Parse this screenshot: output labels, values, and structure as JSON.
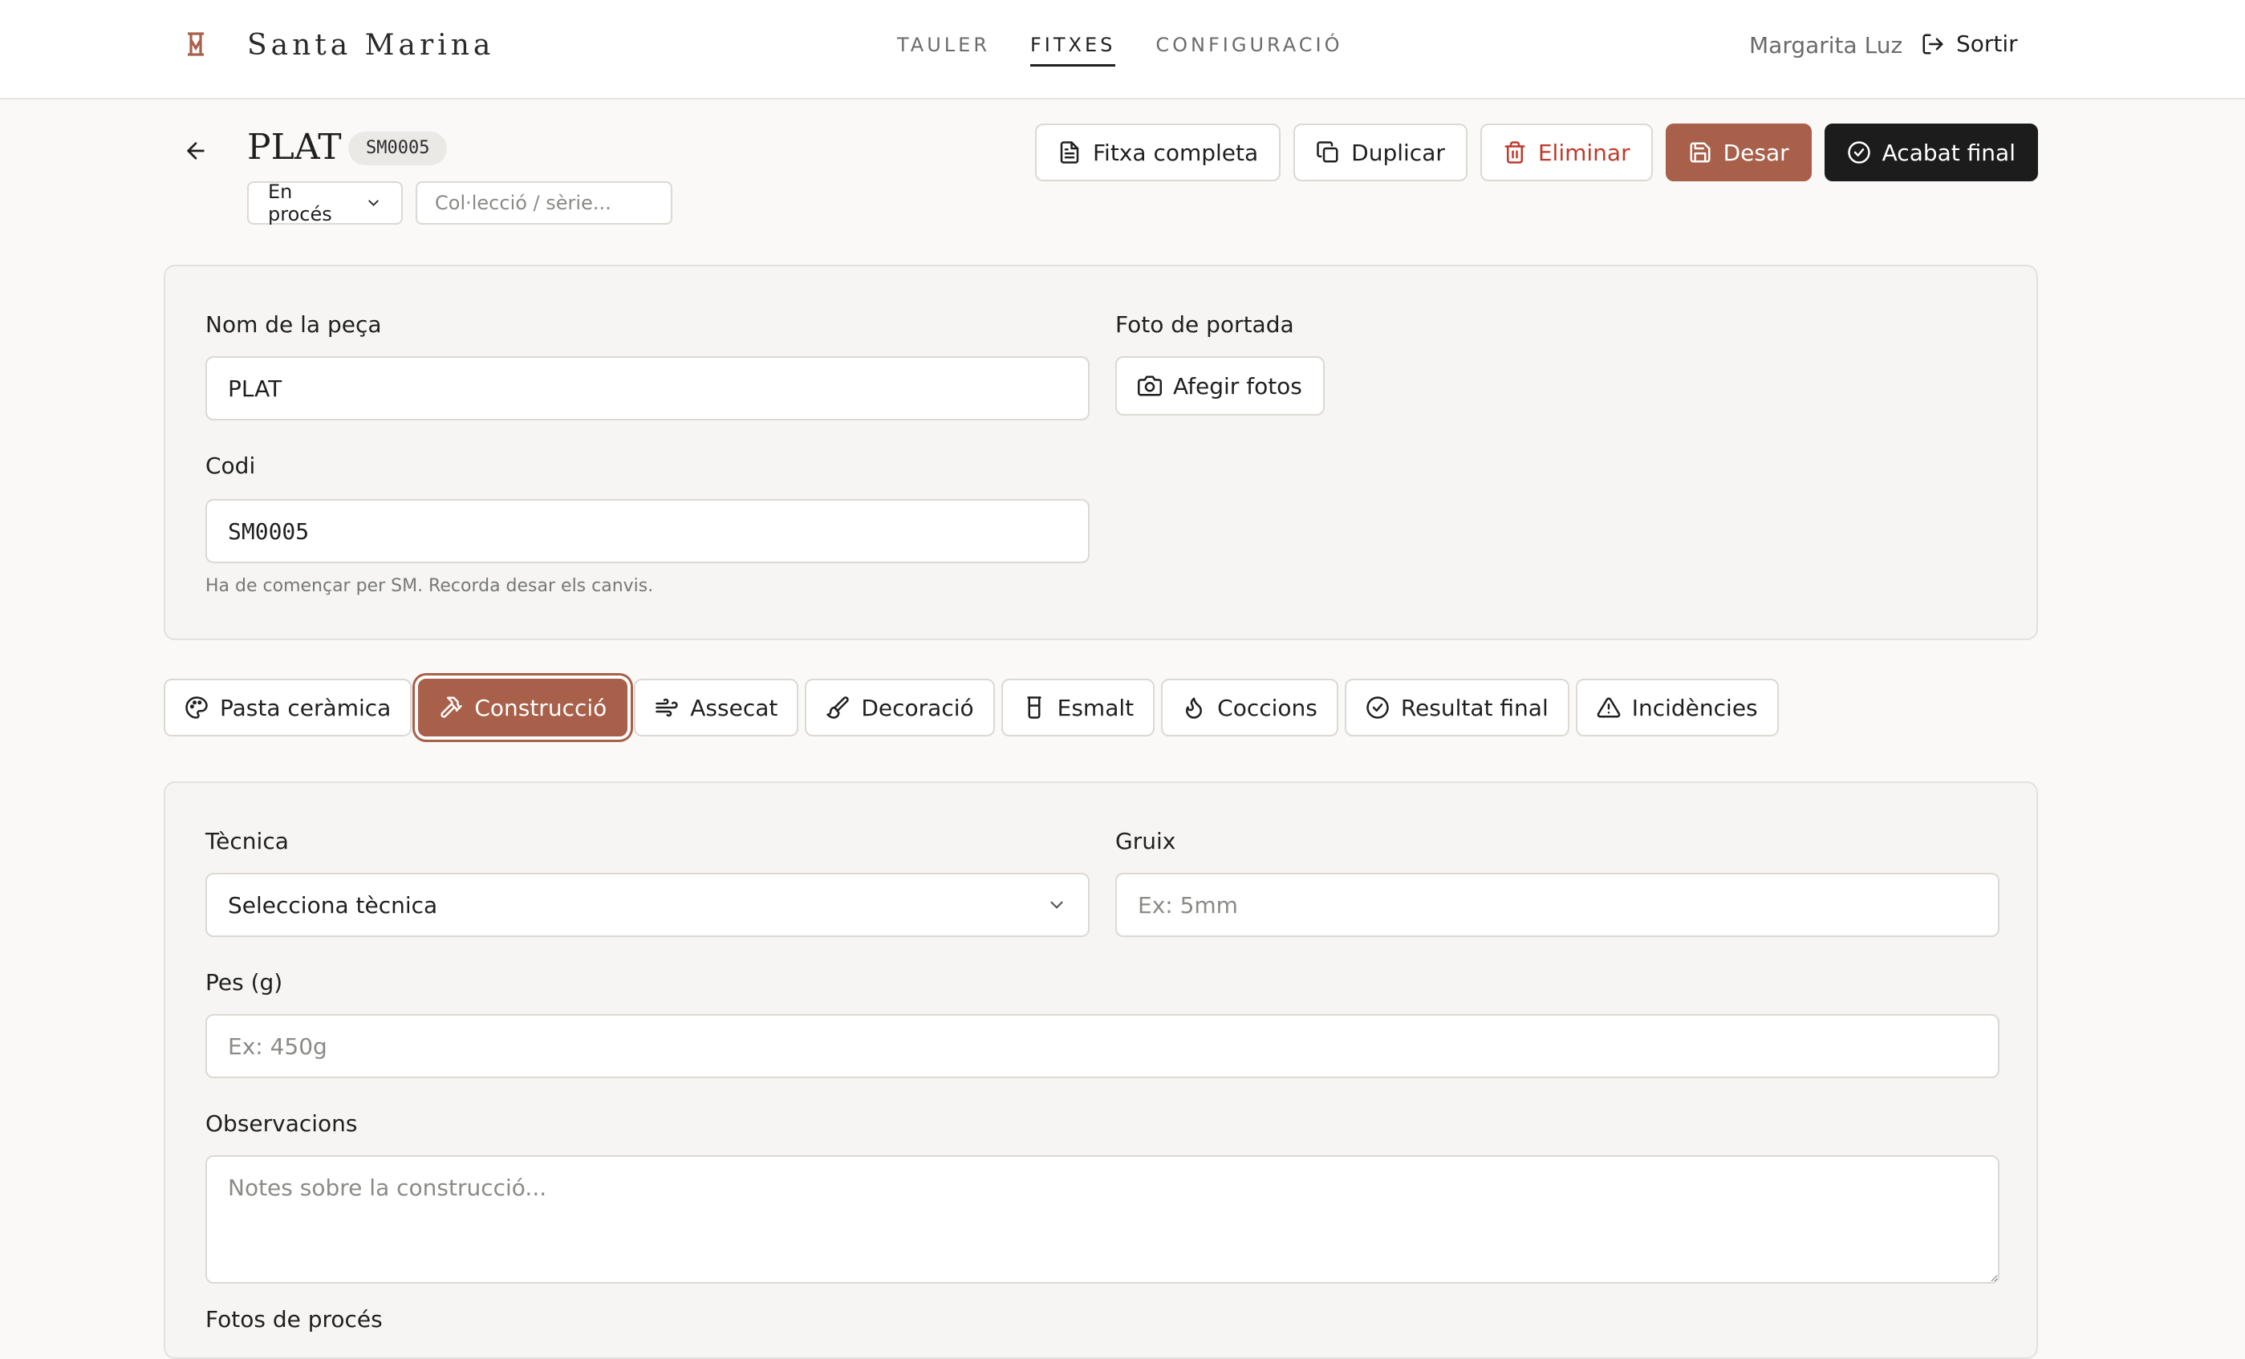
{
  "header": {
    "brand": "Santa Marina",
    "nav": [
      {
        "label": "TAULER",
        "active": false
      },
      {
        "label": "FITXES",
        "active": true
      },
      {
        "label": "CONFIGURACIÓ",
        "active": false
      }
    ],
    "user_name": "Margarita Luz",
    "logout_label": "Sortir",
    "brand_color": "#a8604a"
  },
  "piece": {
    "title": "PLAT",
    "code_badge": "SM0005",
    "status": "En procés",
    "collection_placeholder": "Col·lecció / sèrie..."
  },
  "actions": {
    "full_sheet": "Fitxa completa",
    "duplicate": "Duplicar",
    "delete": "Eliminar",
    "save": "Desar",
    "finish": "Acabat final"
  },
  "general": {
    "name_label": "Nom de la peça",
    "name_value": "PLAT",
    "cover_label": "Foto de portada",
    "add_photos": "Afegir fotos",
    "code_label": "Codi",
    "code_value": "SM0005",
    "code_hint": "Ha de començar per SM. Recorda desar els canvis."
  },
  "tabs": [
    {
      "label": "Pasta ceràmica",
      "icon": "palette-icon"
    },
    {
      "label": "Construcció",
      "icon": "hammer-icon",
      "active": true
    },
    {
      "label": "Assecat",
      "icon": "wind-icon"
    },
    {
      "label": "Decoració",
      "icon": "brush-icon"
    },
    {
      "label": "Esmalt",
      "icon": "glass-icon"
    },
    {
      "label": "Coccions",
      "icon": "flame-icon"
    },
    {
      "label": "Resultat final",
      "icon": "check-circle-icon"
    },
    {
      "label": "Incidències",
      "icon": "warning-icon"
    }
  ],
  "construction": {
    "technique_label": "Tècnica",
    "technique_value": "Selecciona tècnica",
    "thickness_label": "Gruix",
    "thickness_placeholder": "Ex: 5mm",
    "weight_label": "Pes (g)",
    "weight_placeholder": "Ex: 450g",
    "notes_label": "Observacions",
    "notes_placeholder": "Notes sobre la construcció...",
    "photos_label": "Fotos de procés"
  }
}
